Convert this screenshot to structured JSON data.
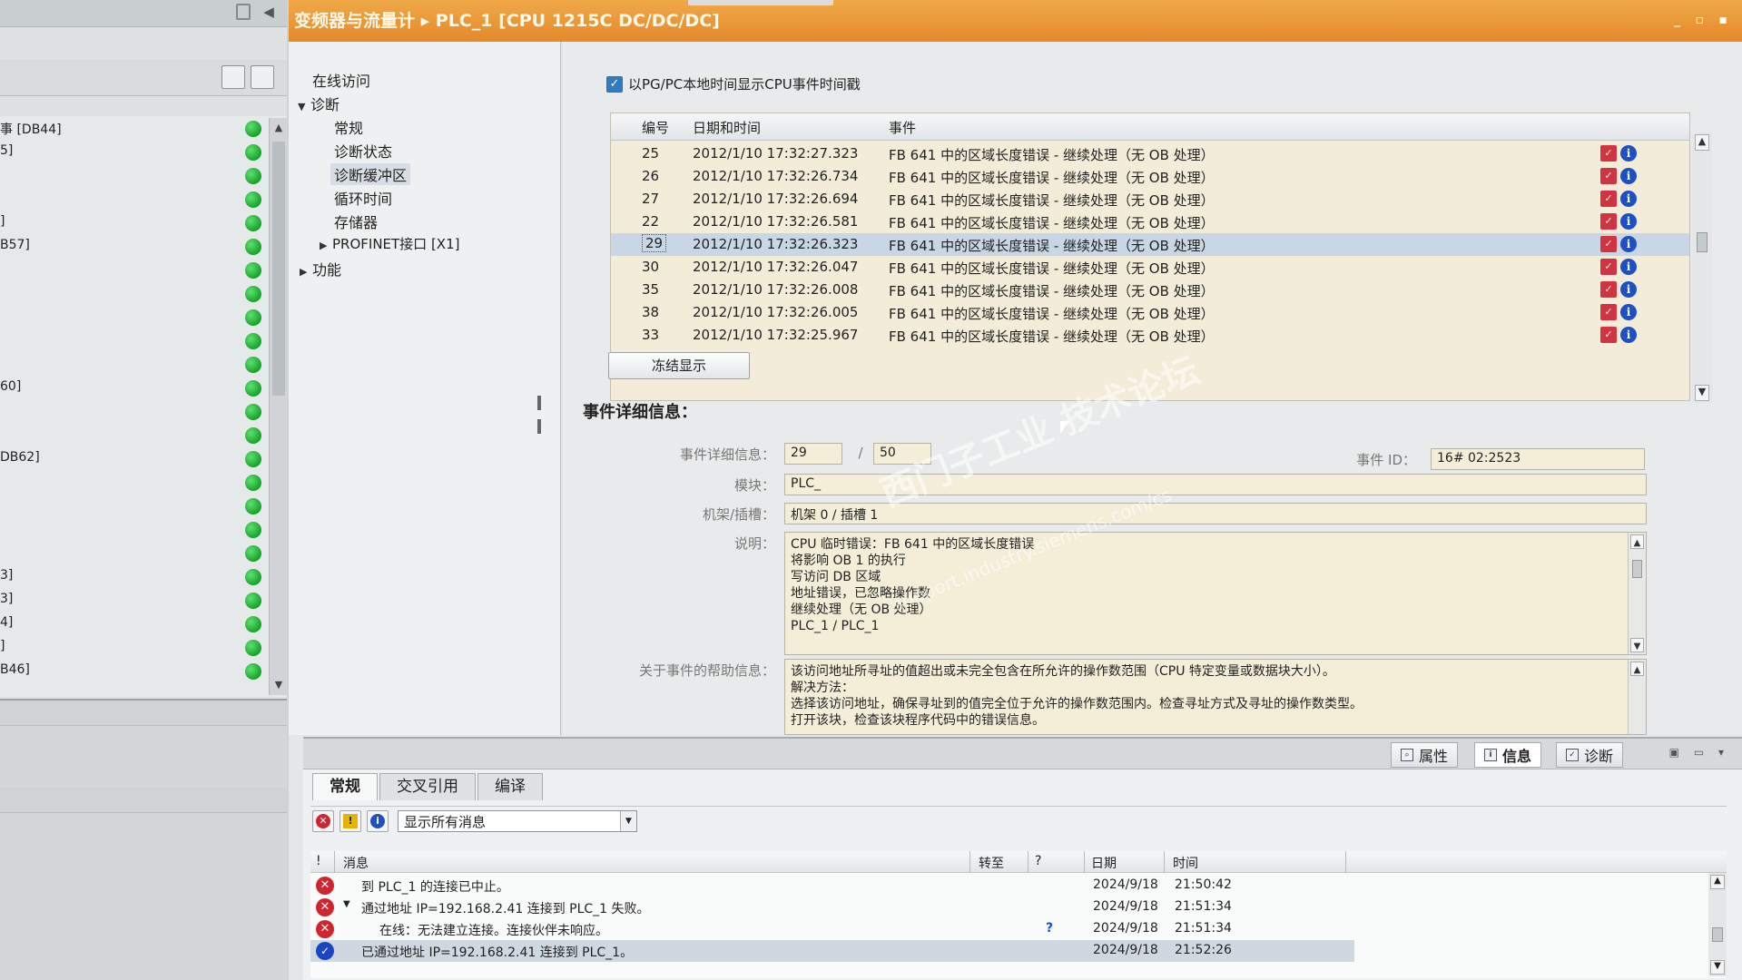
{
  "left_panel": {
    "items": [
      {
        "label": "事 [DB44]"
      },
      {
        "label": "5]"
      },
      {
        "label": ""
      },
      {
        "label": ""
      },
      {
        "label": "]"
      },
      {
        "label": "B57]"
      },
      {
        "label": ""
      },
      {
        "label": ""
      },
      {
        "label": ""
      },
      {
        "label": ""
      },
      {
        "label": ""
      },
      {
        "label": "60]"
      },
      {
        "label": ""
      },
      {
        "label": ""
      },
      {
        "label": "DB62]"
      },
      {
        "label": ""
      },
      {
        "label": ""
      },
      {
        "label": ""
      },
      {
        "label": ""
      },
      {
        "label": "3]"
      },
      {
        "label": "3]"
      },
      {
        "label": "4]"
      },
      {
        "label": "]"
      },
      {
        "label": "B46]"
      }
    ]
  },
  "titlebar": {
    "title": "变频器与流量计 ▸ PLC_1 [CPU 1215C DC/DC/DC]",
    "controls": "_ ▫ ▪"
  },
  "nav": {
    "online_access": "在线访问",
    "diagnostics": "诊断",
    "general": "常规",
    "diag_status": "诊断状态",
    "diag_buffer": "诊断缓冲区",
    "cycle_time": "循环时间",
    "memory": "存储器",
    "profinet": "PROFINET接口 [X1]",
    "functions": "功能"
  },
  "main": {
    "checkbox_label": "以PG/PC本地时间显示CPU事件时间戳",
    "table_headers": {
      "num": "编号",
      "datetime": "日期和时间",
      "event": "事件"
    },
    "events": [
      {
        "num": "25",
        "datetime": "2012/1/10 17:32:27.323",
        "event": "FB 641 中的区域长度错误 - 继续处理（无 OB 处理）"
      },
      {
        "num": "26",
        "datetime": "2012/1/10 17:32:26.734",
        "event": "FB 641 中的区域长度错误 - 继续处理（无 OB 处理）"
      },
      {
        "num": "27",
        "datetime": "2012/1/10 17:32:26.694",
        "event": "FB 641 中的区域长度错误 - 继续处理（无 OB 处理）"
      },
      {
        "num": "22",
        "datetime": "2012/1/10 17:32:26.581",
        "event": "FB 641 中的区域长度错误 - 继续处理（无 OB 处理）"
      },
      {
        "num": "29",
        "datetime": "2012/1/10 17:32:26.323",
        "event": "FB 641 中的区域长度错误 - 继续处理（无 OB 处理）",
        "selected": true
      },
      {
        "num": "30",
        "datetime": "2012/1/10 17:32:26.047",
        "event": "FB 641 中的区域长度错误 - 继续处理（无 OB 处理）"
      },
      {
        "num": "35",
        "datetime": "2012/1/10 17:32:26.008",
        "event": "FB 641 中的区域长度错误 - 继续处理（无 OB 处理）"
      },
      {
        "num": "38",
        "datetime": "2012/1/10 17:32:26.005",
        "event": "FB 641 中的区域长度错误 - 继续处理（无 OB 处理）"
      },
      {
        "num": "33",
        "datetime": "2012/1/10 17:32:25.967",
        "event": "FB 641 中的区域长度错误 - 继续处理（无 OB 处理）"
      }
    ],
    "freeze_button": "冻结显示",
    "details_heading": "事件详细信息：",
    "detail_info_label": "事件详细信息：",
    "detail_num": "29",
    "detail_sep": "/",
    "detail_total": "50",
    "event_id_label": "事件 ID：",
    "event_id": "16# 02:2523",
    "module_label": "模块：",
    "module": "PLC_",
    "rack_slot_label": "机架/插槽：",
    "rack_slot": "机架 0 / 插槽 1",
    "description_label": "说明：",
    "description_lines": [
      "CPU 临时错误：FB 641 中的区域长度错误",
      "将影响 OB 1 的执行",
      "写访问 DB 区域",
      "地址错误，已忽略操作数",
      "继续处理（无 OB 处理）",
      "",
      "PLC_1 / PLC_1"
    ],
    "help_label": "关于事件的帮助信息：",
    "help_lines": [
      "该访问地址所寻址的值超出或未完全包含在所允许的操作数范围（CPU 特定变量或数据块大小）。",
      "解决方法：",
      "选择该访问地址，确保寻址到的值完全位于允许的操作数范围内。检查寻址方式及寻址的操作数类型。",
      "打开该块，检查该块程序代码中的错误信息。"
    ],
    "watermark": "西门子工业 技术论坛",
    "watermark_url": "support.industry.siemens.com/cs"
  },
  "inspector": {
    "tabs": {
      "properties": "属性",
      "info": "信息",
      "diagnostics": "诊断"
    },
    "sub_tabs": {
      "general": "常规",
      "cross_ref": "交叉引用",
      "compile": "编译"
    },
    "filter_value": "显示所有消息",
    "headers": {
      "bang": "!",
      "message": "消息",
      "goto": "转至",
      "q": "?",
      "date": "日期",
      "time": "时间"
    },
    "messages": [
      {
        "type": "error",
        "text": "到 PLC_1 的连接已中止。",
        "date": "2024/9/18",
        "time": "21:50:42",
        "help": ""
      },
      {
        "type": "error",
        "text": "通过地址 IP=192.168.2.41 连接到 PLC_1 失败。",
        "date": "2024/9/18",
        "time": "21:51:34",
        "help": "",
        "expanded": true
      },
      {
        "type": "error",
        "text": "在线：无法建立连接。连接伙伴未响应。",
        "date": "2024/9/18",
        "time": "21:51:34",
        "help": "?"
      },
      {
        "type": "ok",
        "text": "已通过地址 IP=192.168.2.41 连接到 PLC_1。",
        "date": "2024/9/18",
        "time": "21:52:26",
        "help": "",
        "selected": true
      }
    ]
  },
  "colors": {
    "title_orange": "#e3892a",
    "status_green": "#16a32a",
    "error_red": "#d0252f",
    "info_blue": "#1f4fc4",
    "field_bg": "#f4eed9"
  }
}
